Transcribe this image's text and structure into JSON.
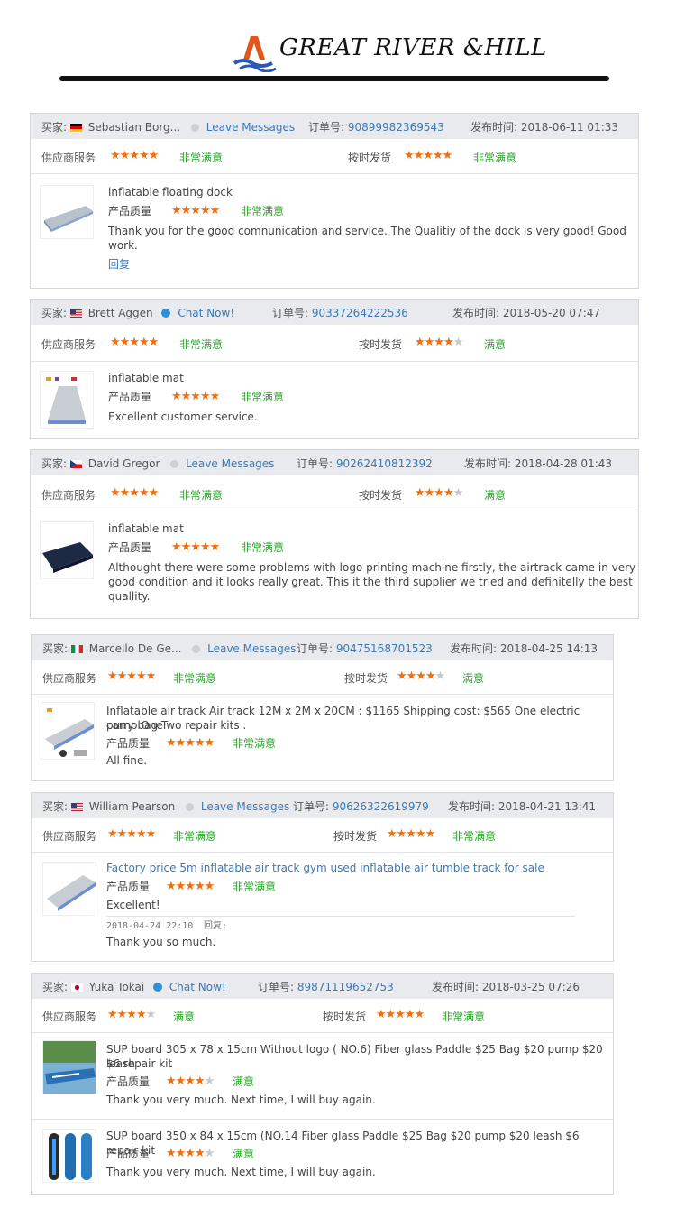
{
  "brand": {
    "name": "GREAT RIVER &HILL"
  },
  "labels": {
    "buyer": "买家:",
    "order_no": "订单号:",
    "published": "发布时间:",
    "supplier_service": "供应商服务",
    "on_time_delivery": "按时发货",
    "product_quality": "产品质量",
    "very_satisfied": "非常满意",
    "satisfied": "满意",
    "reply": "回复",
    "reply_label": "回复:"
  },
  "colors": {
    "accent_blue": "#3b79b8",
    "star": "#ef6f10",
    "green": "#2aa52a",
    "header_bg": "#e9eaee"
  },
  "reviews": [
    {
      "buyer": "Sebastian Borg...",
      "country": "DE",
      "contact": "Leave Messages",
      "order_no": "90899982369543",
      "date": "2018-06-11 01:33",
      "service_rating": 5,
      "service_text": "非常满意",
      "delivery_rating": 5,
      "delivery_text": "非常满意",
      "product": "inflatable floating dock",
      "quality_rating": 5,
      "quality_text": "非常满意",
      "comment_1": "Thank you for the good comnunication and service. The Qualitiy of the dock is very good! Good",
      "comment_2": "work.",
      "reply_link": "回复"
    },
    {
      "buyer": "Brett Aggen",
      "country": "US",
      "contact": "Chat Now!",
      "order_no": "90337264222536",
      "date": "2018-05-20 07:47",
      "service_rating": 5,
      "service_text": "非常满意",
      "delivery_rating": 4,
      "delivery_text": "满意",
      "product": "inflatable mat",
      "quality_rating": 5,
      "quality_text": "非常满意",
      "comment_1": "Excellent customer service."
    },
    {
      "buyer": "David Gregor",
      "country": "CZ",
      "contact": "Leave Messages",
      "order_no": "90262410812392",
      "date": "2018-04-28 01:43",
      "service_rating": 5,
      "service_text": "非常满意",
      "delivery_rating": 4,
      "delivery_text": "满意",
      "product": "inflatable mat",
      "quality_rating": 5,
      "quality_text": "非常满意",
      "comment_1": "Althought there were some problems with logo printing machine firstly, the airtrack came in very",
      "comment_2": "good condition and it looks really great. This it the third supplier we tried and definitelly the best",
      "comment_3": "quallity."
    },
    {
      "buyer": "Marcello De Ge...",
      "country": "IT",
      "contact": "Leave Messages",
      "order_no": "90475168701523",
      "date": "2018-04-25 14:13",
      "service_rating": 5,
      "service_text": "非常满意",
      "delivery_rating": 4,
      "delivery_text": "满意",
      "product_1": "Inflatable air track Air track 12M x 2M x 20CM : $1165 Shipping cost: $565 One electric pump One",
      "product_2": "carry bag Two repair kits .",
      "quality_rating": 5,
      "quality_text": "非常满意",
      "comment_1": "All fine."
    },
    {
      "buyer": "William Pearson",
      "country": "US",
      "contact": "Leave Messages",
      "order_no": "90626322619979",
      "date": "2018-04-21 13:41",
      "service_rating": 5,
      "service_text": "非常满意",
      "delivery_rating": 5,
      "delivery_text": "非常满意",
      "product": "Factory price 5m inflatable air track gym used inflatable air tumble track for sale",
      "quality_rating": 5,
      "quality_text": "非常满意",
      "comment_1": "Excellent!",
      "reply_date": "2018-04-24 22:10",
      "reply_text": "Thank you so much."
    },
    {
      "buyer": "Yuka Tokai",
      "country": "JP",
      "contact": "Chat Now!",
      "order_no": "89871119652753",
      "date": "2018-03-25 07:26",
      "service_rating": 4,
      "service_text": "满意",
      "delivery_rating": 5,
      "delivery_text": "非常满意",
      "items": [
        {
          "product_1": "SUP board 305 x 78 x 15cm Without logo ( NO.6) Fiber glass Paddle $25 Bag $20 pump $20 leash",
          "product_2": "$6 repair kit",
          "quality_rating": 4,
          "quality_text": "满意",
          "comment_1": "Thank you very much. Next time, I will buy again."
        },
        {
          "product_1": "SUP board 350 x 84 x 15cm (NO.14 Fiber glass Paddle $25 Bag $20 pump $20 leash $6 repair kit",
          "quality_rating": 4,
          "quality_text": "满意",
          "comment_1": "Thank you very much. Next time, I will buy again."
        }
      ]
    }
  ]
}
